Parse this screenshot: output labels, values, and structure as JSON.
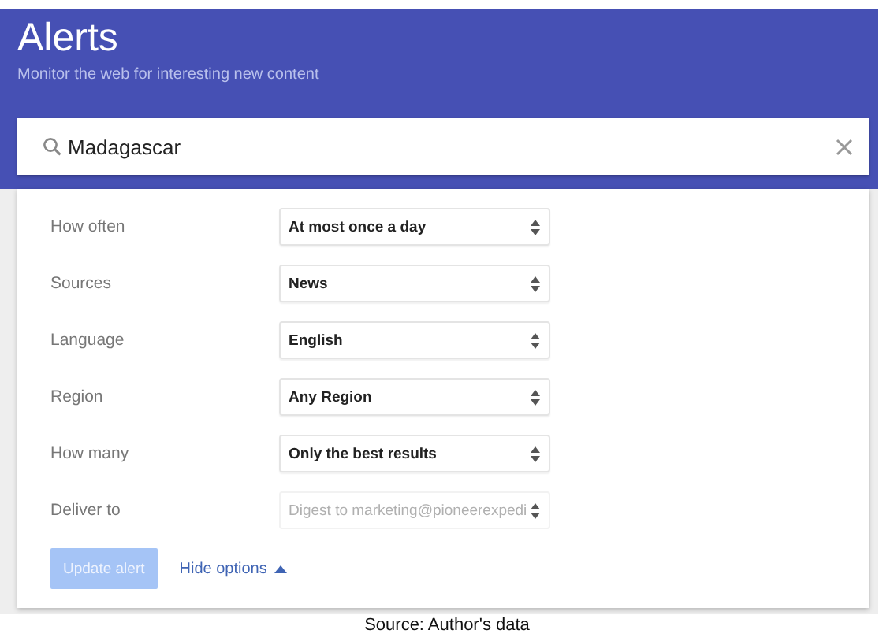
{
  "header": {
    "title": "Alerts",
    "subtitle": "Monitor the web for interesting new content"
  },
  "search": {
    "value": "Madagascar"
  },
  "options": [
    {
      "label": "How often",
      "value": "At most once a day",
      "disabled": false
    },
    {
      "label": "Sources",
      "value": "News",
      "disabled": false
    },
    {
      "label": "Language",
      "value": "English",
      "disabled": false
    },
    {
      "label": "Region",
      "value": "Any Region",
      "disabled": false
    },
    {
      "label": "How many",
      "value": "Only the best results",
      "disabled": false
    },
    {
      "label": "Deliver to",
      "value": "Digest to marketing@pioneerexpedi",
      "disabled": true
    }
  ],
  "update_button": {
    "label": "Update alert",
    "disabled": true
  },
  "options_toggle": {
    "label": "Hide options",
    "expanded": true
  },
  "caption": "Source: Author's data"
}
